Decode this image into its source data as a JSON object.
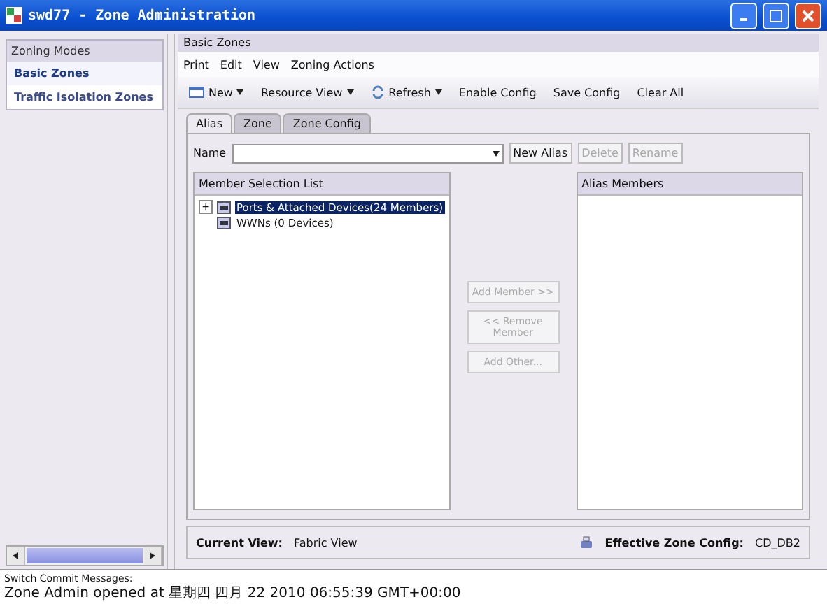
{
  "window": {
    "title": "swd77 - Zone Administration"
  },
  "sidebar": {
    "title": "Zoning Modes",
    "items": [
      {
        "label": "Basic Zones",
        "selected": true
      },
      {
        "label": "Traffic Isolation Zones",
        "selected": false
      }
    ]
  },
  "panel_title": "Basic Zones",
  "menu": [
    "Print",
    "Edit",
    "View",
    "Zoning Actions"
  ],
  "toolbar": [
    {
      "label": "New",
      "kind": "new"
    },
    {
      "label": "Resource View",
      "kind": "plain-dropdown"
    },
    {
      "label": "Refresh",
      "kind": "refresh"
    },
    {
      "label": "Enable Config",
      "kind": "plain"
    },
    {
      "label": "Save Config",
      "kind": "plain"
    },
    {
      "label": "Clear All",
      "kind": "plain"
    }
  ],
  "tabs": [
    {
      "label": "Alias",
      "selected": true
    },
    {
      "label": "Zone",
      "selected": false
    },
    {
      "label": "Zone Config",
      "selected": false
    }
  ],
  "name_field": {
    "label": "Name"
  },
  "name_buttons": [
    {
      "label": "New Alias",
      "disabled": false
    },
    {
      "label": "Delete",
      "disabled": true
    },
    {
      "label": "Rename",
      "disabled": true
    }
  ],
  "member_list": {
    "title": "Member Selection List",
    "items": [
      {
        "label": "Ports & Attached Devices(24 Members)",
        "selected": true,
        "expander": "+"
      },
      {
        "label": "WWNs (0 Devices)",
        "selected": false
      }
    ]
  },
  "move_buttons": [
    {
      "label": "Add Member >>",
      "disabled": true
    },
    {
      "label": "<< Remove Member",
      "disabled": true
    },
    {
      "label": "Add Other...",
      "disabled": true
    }
  ],
  "alias_members": {
    "title": "Alias Members"
  },
  "status": {
    "current_view_label": "Current View:",
    "current_view": "Fabric View",
    "effective_label": "Effective Zone Config:",
    "effective": "CD_DB2"
  },
  "messages": [
    "Switch Commit Messages:",
    "Zone Admin opened at 星期四 四月 22 2010 06:55:39 GMT+00:00"
  ]
}
